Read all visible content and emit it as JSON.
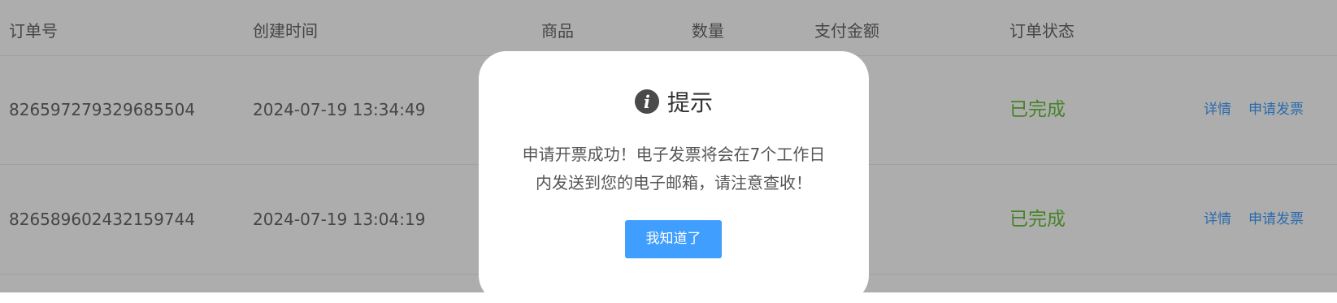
{
  "table": {
    "headers": {
      "order_no": "订单号",
      "created_time": "创建时间",
      "product": "商品",
      "quantity": "数量",
      "payment_amount": "支付金额",
      "order_status": "订单状态"
    },
    "rows": [
      {
        "order_no": "826597279329685504",
        "created_time": "2024-07-19 13:34:49",
        "status": "已完成",
        "action_detail": "详情",
        "action_invoice": "申请发票"
      },
      {
        "order_no": "826589602432159744",
        "created_time": "2024-07-19 13:04:19",
        "status": "已完成",
        "action_detail": "详情",
        "action_invoice": "申请发票"
      }
    ]
  },
  "dialog": {
    "icon": "info-icon",
    "title": "提示",
    "message_line1": "申请开票成功！电子发票将会在7个工作日",
    "message_line2": "内发送到您的电子邮箱，请注意查收！",
    "confirm_label": "我知道了"
  },
  "colors": {
    "status_success": "#67c23a",
    "link": "#409eff",
    "button": "#409eff"
  }
}
